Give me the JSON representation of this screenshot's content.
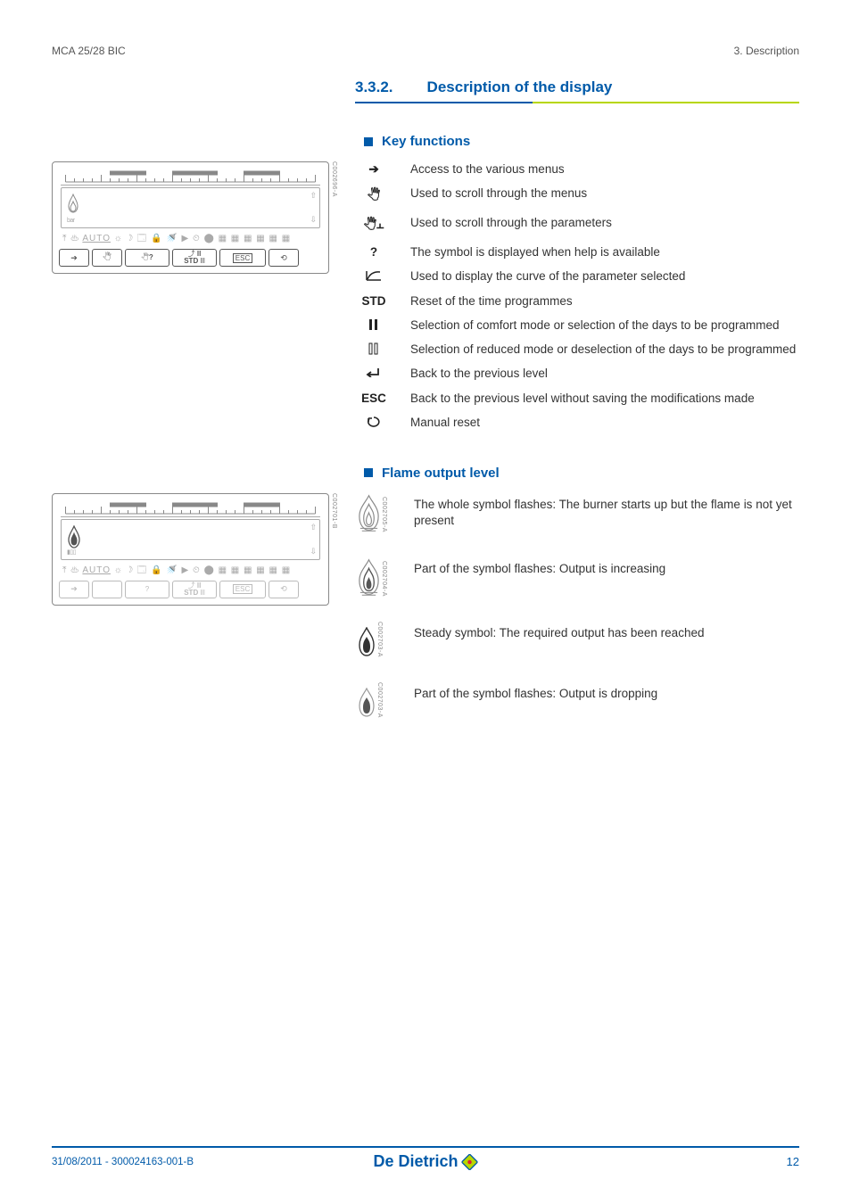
{
  "header": {
    "left": "MCA 25/28 BIC",
    "right": "3.  Description"
  },
  "section": {
    "number": "3.3.2.",
    "title": "Description of the display"
  },
  "sub1": {
    "title": "Key functions",
    "diagram_code": "C002696-A",
    "lcd": {
      "icons_row": "AUTO",
      "btn_std_top": "STD",
      "btn_esc": "ESC",
      "bar_label": "bar"
    },
    "keys": [
      {
        "sym": "arrow-right",
        "desc": "Access to the various menus"
      },
      {
        "sym": "scroll-menu",
        "desc": "Used to scroll through the menus"
      },
      {
        "sym": "scroll-param",
        "desc": "Used to scroll through the parameters"
      },
      {
        "sym": "question",
        "desc": "The symbol is displayed when help is available"
      },
      {
        "sym": "curve",
        "desc": "Used to display the curve of the parameter selected"
      },
      {
        "sym": "STD",
        "desc": "Reset of the time programmes"
      },
      {
        "sym": "bars-full",
        "desc": "Selection of comfort mode or selection of the days to be programmed"
      },
      {
        "sym": "bars-half",
        "desc": "Selection of reduced mode or deselection of the days to be programmed"
      },
      {
        "sym": "back",
        "desc": "Back to the previous level"
      },
      {
        "sym": "ESC",
        "desc": "Back to the previous level without saving the modifications made"
      },
      {
        "sym": "reset",
        "desc": "Manual reset"
      }
    ]
  },
  "sub2": {
    "title": "Flame output level",
    "diagram_code": "C002701-B",
    "items": [
      {
        "code": "C002705-A",
        "desc": "The whole symbol flashes: The burner starts up but the flame is not yet present"
      },
      {
        "code": "C002704-A",
        "desc": "Part of the symbol flashes: Output is increasing"
      },
      {
        "code": "C002703-A",
        "desc": "Steady symbol: The required output has been reached"
      },
      {
        "code": "C002703-A",
        "desc": "Part of the symbol flashes: Output is dropping"
      }
    ]
  },
  "footer": {
    "left": "31/08/2011  - 300024163-001-B",
    "brand": "De Dietrich",
    "page": "12"
  }
}
